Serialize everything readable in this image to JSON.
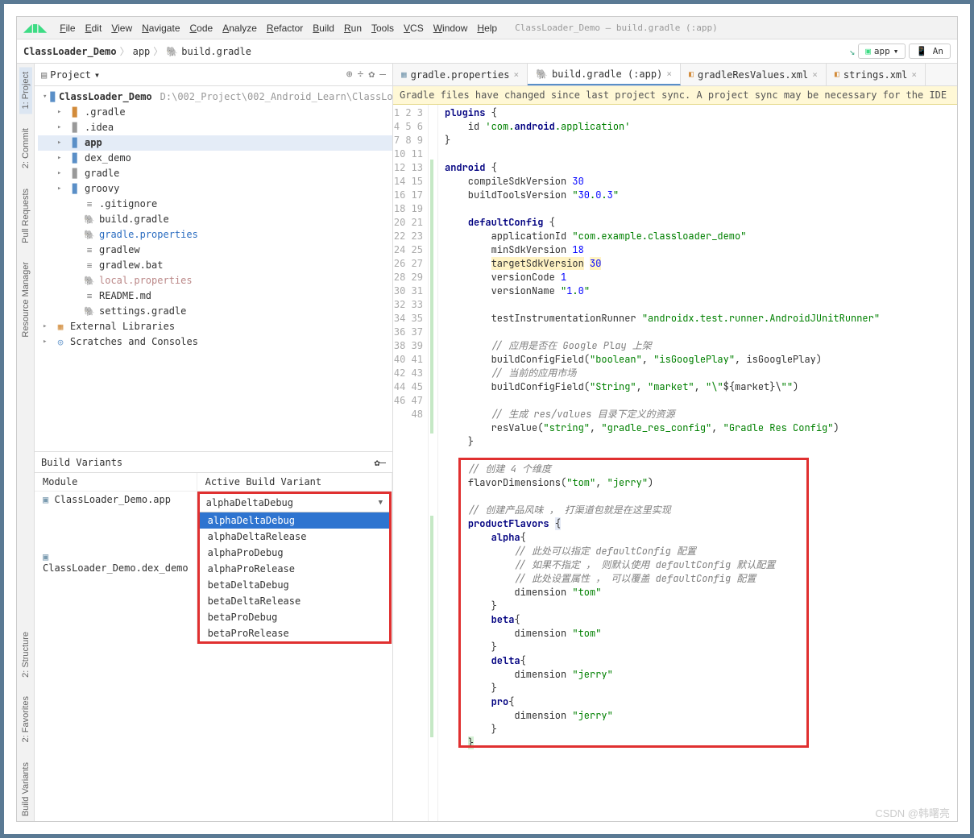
{
  "menubar": {
    "items": [
      "File",
      "Edit",
      "View",
      "Navigate",
      "Code",
      "Analyze",
      "Refactor",
      "Build",
      "Run",
      "Tools",
      "VCS",
      "Window",
      "Help"
    ],
    "context": "ClassLoader_Demo – build.gradle (:app)"
  },
  "breadcrumb": {
    "items": [
      "ClassLoader_Demo",
      "app",
      "build.gradle"
    ],
    "run_config": "app"
  },
  "project_tool": {
    "title": "Project",
    "tree": [
      {
        "depth": 0,
        "arrow": "▾",
        "icon": "folder-blue",
        "label": "ClassLoader_Demo",
        "path": "D:\\002_Project\\002_Android_Learn\\ClassLo",
        "bold": true
      },
      {
        "depth": 1,
        "arrow": "▸",
        "icon": "folder-orange",
        "label": ".gradle"
      },
      {
        "depth": 1,
        "arrow": "▸",
        "icon": "folder-grey",
        "label": ".idea"
      },
      {
        "depth": 1,
        "arrow": "▸",
        "icon": "folder-blue",
        "label": "app",
        "bold": true,
        "hl": true
      },
      {
        "depth": 1,
        "arrow": "▸",
        "icon": "folder-blue",
        "label": "dex_demo"
      },
      {
        "depth": 1,
        "arrow": "▸",
        "icon": "folder-grey",
        "label": "gradle"
      },
      {
        "depth": 1,
        "arrow": "▸",
        "icon": "folder-blue",
        "label": "groovy"
      },
      {
        "depth": 2,
        "arrow": "",
        "icon": "file",
        "label": ".gitignore"
      },
      {
        "depth": 2,
        "arrow": "",
        "icon": "elephant",
        "label": "build.gradle"
      },
      {
        "depth": 2,
        "arrow": "",
        "icon": "elephant",
        "label": "gradle.properties",
        "link": true
      },
      {
        "depth": 2,
        "arrow": "",
        "icon": "file",
        "label": "gradlew"
      },
      {
        "depth": 2,
        "arrow": "",
        "icon": "file",
        "label": "gradlew.bat"
      },
      {
        "depth": 2,
        "arrow": "",
        "icon": "elephant",
        "label": "local.properties",
        "muted": true
      },
      {
        "depth": 2,
        "arrow": "",
        "icon": "file",
        "label": "README.md"
      },
      {
        "depth": 2,
        "arrow": "",
        "icon": "elephant",
        "label": "settings.gradle"
      },
      {
        "depth": 0,
        "arrow": "▸",
        "icon": "lib",
        "label": "External Libraries"
      },
      {
        "depth": 0,
        "arrow": "▸",
        "icon": "scratch",
        "label": "Scratches and Consoles"
      }
    ]
  },
  "build_variants": {
    "title": "Build Variants",
    "columns": [
      "Module",
      "Active Build Variant"
    ],
    "rows": [
      {
        "module": "ClassLoader_Demo.app",
        "variant": "alphaDeltaDebug"
      },
      {
        "module": "ClassLoader_Demo.dex_demo",
        "variant": ""
      }
    ],
    "dropdown_options": [
      "alphaDeltaDebug",
      "alphaDeltaRelease",
      "alphaProDebug",
      "alphaProRelease",
      "betaDeltaDebug",
      "betaDeltaRelease",
      "betaProDebug",
      "betaProRelease"
    ],
    "dropdown_selected": "alphaDeltaDebug"
  },
  "left_gutter_tabs": [
    "1: Project",
    "2: Commit",
    "Pull Requests",
    "Resource Manager",
    "2: Structure",
    "2: Favorites",
    "Build Variants"
  ],
  "editor": {
    "tabs": [
      {
        "label": "gradle.properties",
        "icon": "prop",
        "active": false
      },
      {
        "label": "build.gradle (:app)",
        "icon": "elephant",
        "active": true
      },
      {
        "label": "gradleResValues.xml",
        "icon": "xml",
        "active": false
      },
      {
        "label": "strings.xml",
        "icon": "xml",
        "active": false
      }
    ],
    "sync_banner": "Gradle files have changed since last project sync. A project sync may be necessary for the IDE",
    "line_start": 1,
    "line_end": 48
  },
  "code_lines": [
    "plugins {",
    "    id 'com.android.application'",
    "}",
    "",
    "android {",
    "    compileSdkVersion 30",
    "    buildToolsVersion \"30.0.3\"",
    "",
    "    defaultConfig {",
    "        applicationId \"com.example.classloader_demo\"",
    "        minSdkVersion 18",
    "        targetSdkVersion 30",
    "        versionCode 1",
    "        versionName \"1.0\"",
    "",
    "        testInstrumentationRunner \"androidx.test.runner.AndroidJUnitRunner\"",
    "",
    "        // 应用是否在 Google Play 上架",
    "        buildConfigField(\"boolean\", \"isGooglePlay\", isGooglePlay)",
    "        // 当前的应用市场",
    "        buildConfigField(\"String\", \"market\", \"\\\"${market}\\\"\")",
    "",
    "        // 生成 res/values 目录下定义的资源",
    "        resValue(\"string\", \"gradle_res_config\", \"Gradle Res Config\")",
    "    }",
    "",
    "    // 创建 4 个维度",
    "    flavorDimensions(\"tom\", \"jerry\")",
    "",
    "    // 创建产品风味 ， 打渠道包就是在这里实现",
    "    productFlavors {",
    "        alpha{",
    "            // 此处可以指定 defaultConfig 配置",
    "            // 如果不指定 ， 则默认使用 defaultConfig 默认配置",
    "            // 此处设置属性 ， 可以覆盖 defaultConfig 配置",
    "            dimension \"tom\"",
    "        }",
    "        beta{",
    "            dimension \"tom\"",
    "        }",
    "        delta{",
    "            dimension \"jerry\"",
    "        }",
    "        pro{",
    "            dimension \"jerry\"",
    "        }",
    "    }",
    ""
  ],
  "watermark": "CSDN @韩曙亮"
}
